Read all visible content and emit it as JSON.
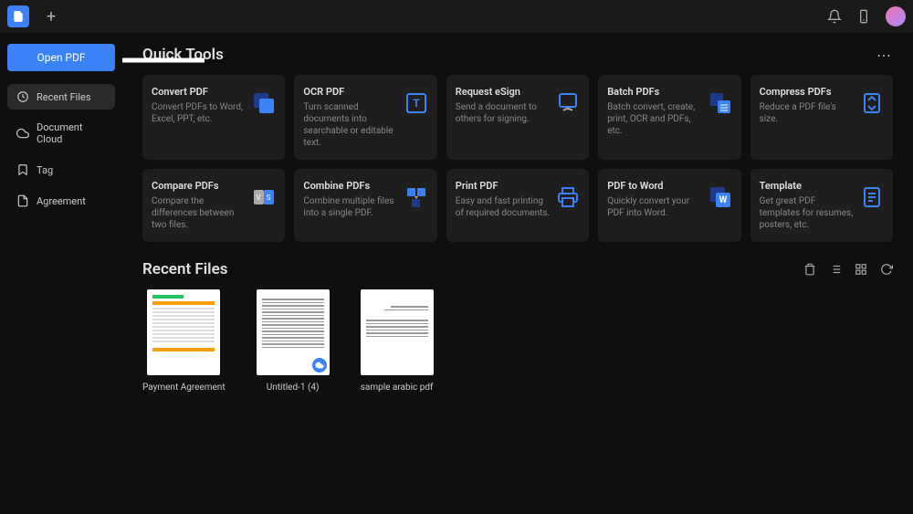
{
  "sidebar": {
    "open_label": "Open PDF",
    "items": [
      {
        "label": "Recent Files",
        "icon": "clock-icon",
        "active": true
      },
      {
        "label": "Document Cloud",
        "icon": "cloud-icon"
      },
      {
        "label": "Tag",
        "icon": "bookmark-icon"
      },
      {
        "label": "Agreement",
        "icon": "file-icon"
      }
    ]
  },
  "quick_tools": {
    "title": "Quick Tools",
    "tools": [
      {
        "title": "Convert PDF",
        "desc": "Convert PDFs to Word, Excel, PPT, etc."
      },
      {
        "title": "OCR PDF",
        "desc": "Turn scanned documents into searchable or editable text."
      },
      {
        "title": "Request eSign",
        "desc": "Send a document to others for signing."
      },
      {
        "title": "Batch PDFs",
        "desc": "Batch convert, create, print, OCR and PDFs, etc."
      },
      {
        "title": "Compress PDFs",
        "desc": "Reduce a PDF file's size."
      },
      {
        "title": "Compare PDFs",
        "desc": "Compare the differences between two files."
      },
      {
        "title": "Combine PDFs",
        "desc": "Combine multiple files into a single PDF."
      },
      {
        "title": "Print PDF",
        "desc": "Easy and fast printing of required documents."
      },
      {
        "title": "PDF to Word",
        "desc": "Quickly convert your PDF into Word."
      },
      {
        "title": "Template",
        "desc": "Get great PDF templates for resumes, posters, etc."
      }
    ]
  },
  "recent_files": {
    "title": "Recent Files",
    "files": [
      {
        "name": "Payment Agreement"
      },
      {
        "name": "Untitled-1 (4)"
      },
      {
        "name": "sample arabic pdf"
      }
    ]
  }
}
